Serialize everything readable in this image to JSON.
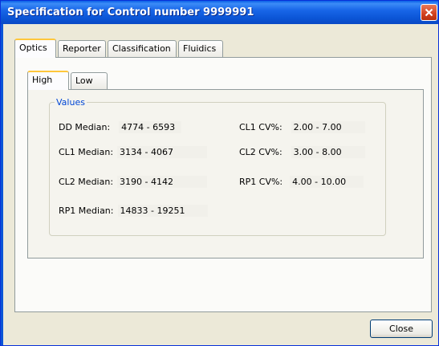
{
  "window": {
    "title": "Specification for Control number 9999991",
    "close_icon": "close-icon",
    "colors": {
      "titlebar": "#0b55d6",
      "close": "#d2401f",
      "tab_highlight": "#ffc73c",
      "group_legend": "#0046d5"
    }
  },
  "outer_tabs": [
    {
      "label": "Optics",
      "active": true
    },
    {
      "label": "Reporter",
      "active": false
    },
    {
      "label": "Classification",
      "active": false
    },
    {
      "label": "Fluidics",
      "active": false
    }
  ],
  "inner_tabs": [
    {
      "label": "High",
      "active": true
    },
    {
      "label": "Low",
      "active": false
    }
  ],
  "values": {
    "legend": "Values",
    "fields": [
      {
        "label": "DD Median:",
        "value": "4774 - 6593"
      },
      {
        "label": "CL1 Median:",
        "value": "3134 - 4067"
      },
      {
        "label": "CL2 Median:",
        "value": "3190 - 4142"
      },
      {
        "label": "RP1 Median:",
        "value": "14833 - 19251"
      },
      {
        "label": "CL1 CV%:",
        "value": "2.00 - 7.00"
      },
      {
        "label": "CL2 CV%:",
        "value": "3.00 - 8.00"
      },
      {
        "label": "RP1 CV%:",
        "value": "4.00 - 10.00"
      }
    ]
  },
  "footer": {
    "close_label": "Close"
  }
}
